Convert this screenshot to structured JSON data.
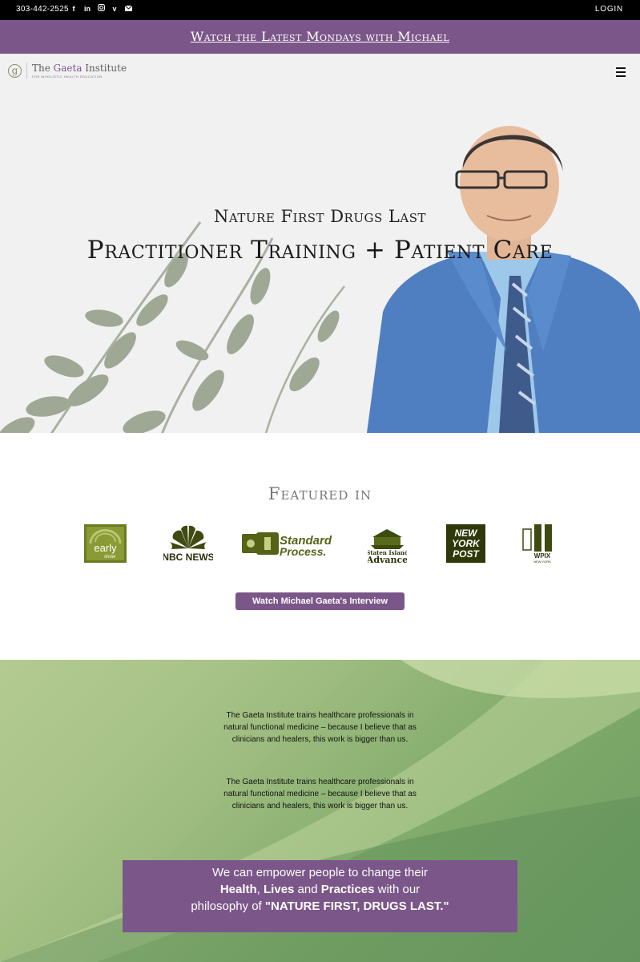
{
  "topbar": {
    "phone": "303-442-2525",
    "login": "LOGIN",
    "socials": [
      "facebook-icon",
      "linkedin-icon",
      "instagram-icon",
      "vimeo-icon",
      "email-icon"
    ]
  },
  "banner": {
    "link": "Watch the Latest Mondays with Michael"
  },
  "header": {
    "logo_letter": "g",
    "logo_name_1": "The ",
    "logo_name_2": "Gaeta",
    "logo_name_3": " Institute",
    "logo_tagline": "FOR WHOLISTIC HEALTH EDUCATION"
  },
  "hero": {
    "subtitle": "Nature First Drugs Last",
    "title": "Practitioner Training + Patient Care"
  },
  "featured": {
    "title": "Featured in",
    "logos": [
      {
        "name": "The Early Show",
        "text_1": "early",
        "text_2": "show"
      },
      {
        "name": "NBC News",
        "text": "NBC NEWS"
      },
      {
        "name": "Standard Process",
        "text_1": "Standard",
        "text_2": "Process."
      },
      {
        "name": "Staten Island Advance",
        "text_1": "Staten Island",
        "text_2": "Advance"
      },
      {
        "name": "New York Post",
        "text_1": "NEW",
        "text_2": "YORK",
        "text_3": "POST"
      },
      {
        "name": "WPIX New York",
        "text_1": "WPIX",
        "text_2": "NEW YORK"
      }
    ],
    "button": "Watch Michael Gaeta's Interview"
  },
  "mission": {
    "para_1": "The Gaeta Institute trains healthcare professionals in natural functional medicine – because I believe that as clinicians and healers, this work is bigger than us.",
    "para_2": "The Gaeta Institute trains healthcare professionals in natural functional medicine – because I believe that as clinicians and healers, this work is bigger than us.",
    "quote_1": "We can empower people to change their",
    "quote_b1": "Health",
    "quote_sep1": ", ",
    "quote_b2": "Lives",
    "quote_sep2": " and ",
    "quote_b3": "Practices",
    "quote_2": " with our",
    "quote_3": "philosophy of ",
    "quote_b4": "\"NATURE FIRST, DRUGS LAST.\""
  },
  "colors": {
    "brand_purple": "#7b5688",
    "logo_green": "#5f6b22"
  }
}
